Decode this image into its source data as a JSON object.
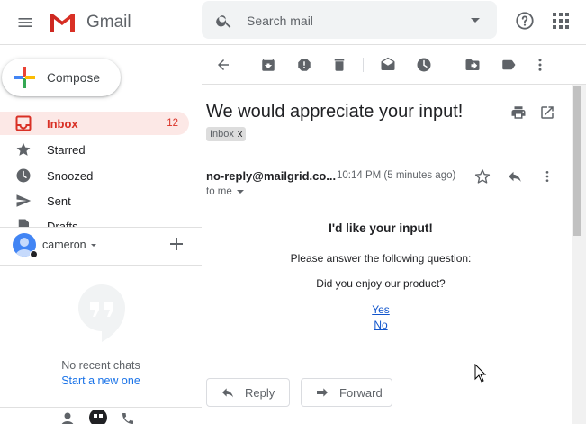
{
  "app": {
    "name": "Gmail"
  },
  "colors": {
    "accent_red": "#d93025",
    "link_blue": "#1a73e8",
    "active_nav_bg": "#fce8e6",
    "search_bg": "#f1f3f4"
  },
  "header": {
    "logo_text": "Gmail",
    "search_placeholder": "Search mail",
    "icons": [
      "menu-icon",
      "gmail-logo-icon",
      "search-icon",
      "search-options-icon",
      "help-icon",
      "apps-grid-icon"
    ]
  },
  "sidebar": {
    "compose_label": "Compose",
    "items": [
      {
        "label": "Inbox",
        "count": "12",
        "icon": "inbox-icon",
        "active": true
      },
      {
        "label": "Starred",
        "count": "",
        "icon": "star-icon",
        "active": false
      },
      {
        "label": "Snoozed",
        "count": "",
        "icon": "clock-icon",
        "active": false
      },
      {
        "label": "Sent",
        "count": "",
        "icon": "send-icon",
        "active": false
      },
      {
        "label": "Drafts",
        "count": "",
        "icon": "draft-icon",
        "active": false
      }
    ]
  },
  "hangouts": {
    "user_name": "cameron",
    "no_chats_text": "No recent chats",
    "start_chat_link": "Start a new one"
  },
  "toolbar": {
    "icons": [
      "back-arrow-icon",
      "archive-icon",
      "report-spam-icon",
      "delete-icon",
      "mark-unread-icon",
      "snooze-icon",
      "move-to-icon",
      "labels-icon",
      "more-vert-icon"
    ]
  },
  "email": {
    "subject": "We would appreciate your input!",
    "label": "Inbox",
    "label_remove": "x",
    "sender": "no-reply@mailgrid.co...",
    "timestamp": "10:14 PM (5 minutes ago)",
    "recipient": "to me",
    "body": {
      "heading": "I'd like your input!",
      "line1": "Please answer the following question:",
      "line2": "Did you enjoy our product?",
      "link_yes": "Yes",
      "link_no": "No"
    },
    "reply_label": "Reply",
    "forward_label": "Forward"
  }
}
